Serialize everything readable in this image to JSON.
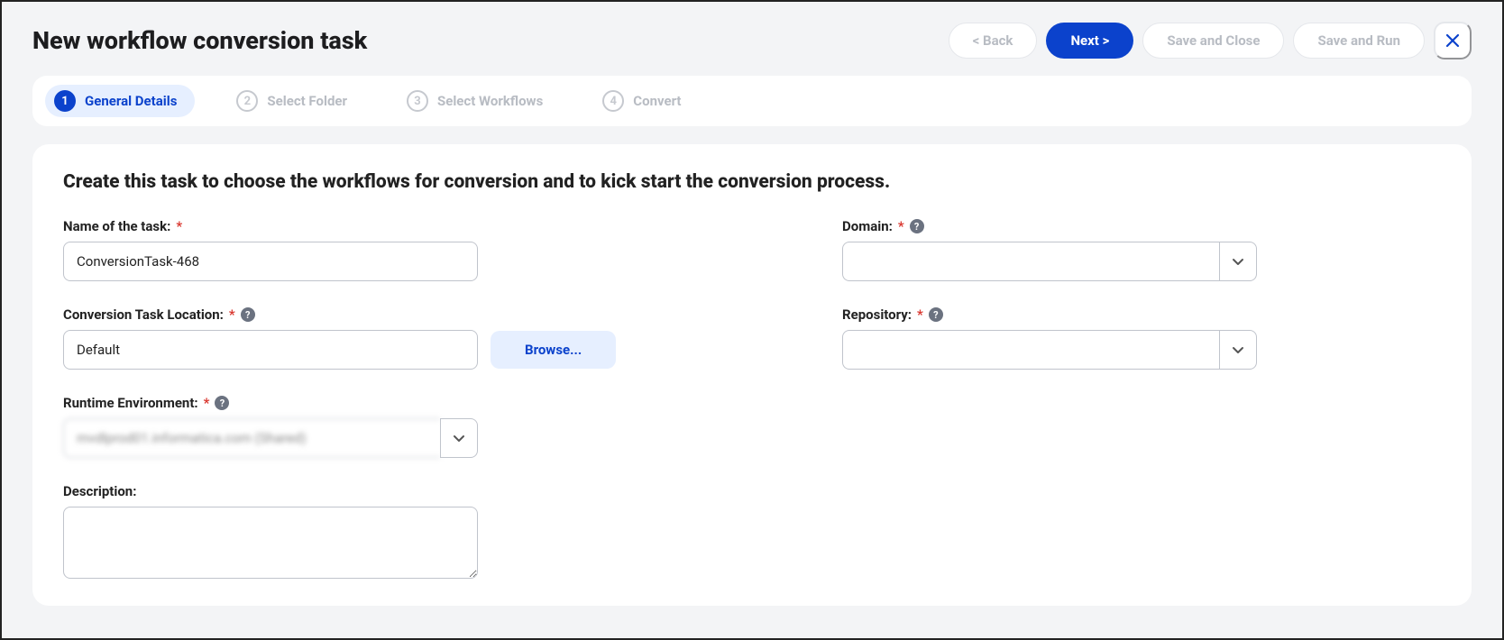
{
  "header": {
    "title": "New workflow conversion task",
    "back": "< Back",
    "next": "Next >",
    "save_close": "Save and Close",
    "save_run": "Save and Run"
  },
  "stepper": {
    "steps": [
      {
        "num": "1",
        "label": "General Details"
      },
      {
        "num": "2",
        "label": "Select Folder"
      },
      {
        "num": "3",
        "label": "Select Workflows"
      },
      {
        "num": "4",
        "label": "Convert"
      }
    ],
    "active_index": 0
  },
  "panel": {
    "heading": "Create this task to choose the workflows for conversion and to kick start the conversion process."
  },
  "form": {
    "name_label": "Name of the task:",
    "name_value": "ConversionTask-468",
    "domain_label": "Domain:",
    "domain_value": "",
    "location_label": "Conversion Task Location:",
    "location_value": "Default",
    "browse_label": "Browse...",
    "repo_label": "Repository:",
    "repo_value": "",
    "runtime_label": "Runtime Environment:",
    "runtime_value": "mvdlprod01.informatica.com (Shared)",
    "description_label": "Description:",
    "description_value": ""
  }
}
